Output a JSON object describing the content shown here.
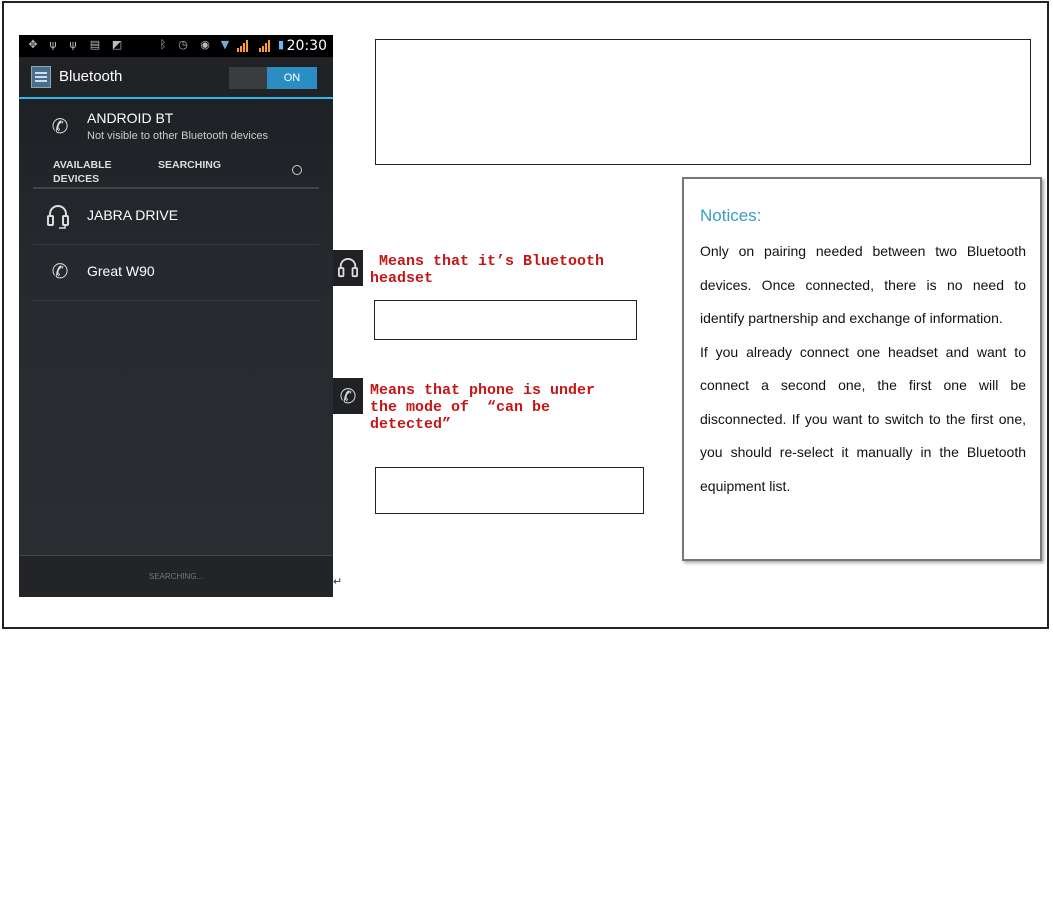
{
  "statusbar": {
    "time": "20:30",
    "icons": [
      "usb-icon",
      "usb-icon",
      "usb-icon",
      "message-icon",
      "image-icon",
      "bluetooth-icon",
      "alarm-icon",
      "sync-icon",
      "wifi-icon",
      "signal-icon",
      "signal-icon",
      "battery-icon"
    ]
  },
  "actionbar": {
    "title": "Bluetooth",
    "toggle_label": "ON"
  },
  "device": {
    "name": "ANDROID BT",
    "subtitle": "Not visible to other Bluetooth devices"
  },
  "section": {
    "available_line1": "AVAILABLE",
    "available_line2": "DEVICES",
    "searching": "SEARCHING"
  },
  "devices": [
    {
      "name": "JABRA DRIVE",
      "icon": "headset-icon"
    },
    {
      "name": "Great W90",
      "icon": "phone-icon"
    }
  ],
  "bottom_button": "SEARCHING...",
  "return_mark": "↵",
  "annotations": {
    "headset_note": " Means that it’s Bluetooth\nheadset",
    "phone_note": "Means that phone is under\nthe mode of  “can be\ndetected”"
  },
  "notices": {
    "title": "Notices:",
    "paragraph1": "Only on pairing needed between two Bluetooth devices. Once connected, there is no need to identify partnership and exchange of information.",
    "paragraph2": "If you already connect one headset and want to connect a second one, the first one will be disconnected. If you want to switch to the first one, you should re-select it manually in the Bluetooth equipment list."
  },
  "colors": {
    "accent": "#33b5e5",
    "toggle_on": "#2a8ec2",
    "note_red": "#c41616",
    "notice_title": "#3a9bc9"
  }
}
